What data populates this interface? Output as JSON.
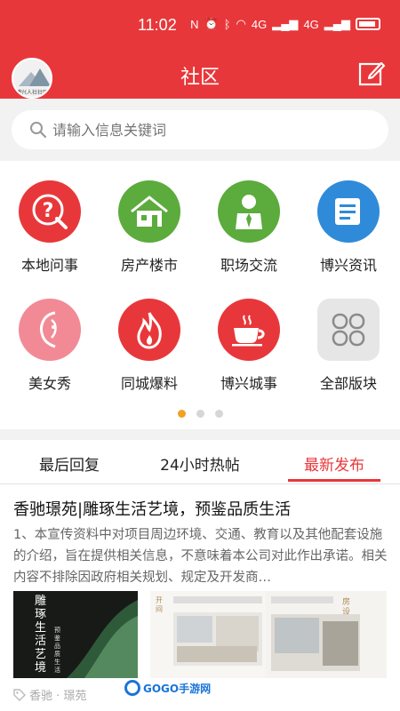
{
  "status_bar": {
    "time": "11:02",
    "network_labels": [
      "4G",
      "4G"
    ]
  },
  "header": {
    "title": "社区",
    "avatar_caption": "博兴人社社区"
  },
  "search": {
    "placeholder": "请输入信息关键词"
  },
  "categories": [
    {
      "label": "本地问事",
      "icon": "question-pen-icon",
      "color": "#e8373a"
    },
    {
      "label": "房产楼市",
      "icon": "house-icon",
      "color": "#5cab3d"
    },
    {
      "label": "职场交流",
      "icon": "businessman-icon",
      "color": "#5cab3d"
    },
    {
      "label": "博兴资讯",
      "icon": "document-icon",
      "color": "#2f8bd9"
    },
    {
      "label": "美女秀",
      "icon": "woman-face-icon",
      "color": "#f28a96"
    },
    {
      "label": "同城爆料",
      "icon": "fire-icon",
      "color": "#e8373a"
    },
    {
      "label": "博兴城事",
      "icon": "coffee-cup-icon",
      "color": "#e8373a"
    },
    {
      "label": "全部版块",
      "icon": "grid-all-icon",
      "color": "#e6e6e6"
    }
  ],
  "pagination": {
    "pages": 3,
    "active": 1,
    "active_color": "#f2a024"
  },
  "tabs": [
    {
      "label": "最后回复",
      "active": false
    },
    {
      "label": "24小时热帖",
      "active": false
    },
    {
      "label": "最新发布",
      "active": true
    }
  ],
  "article": {
    "title": "香驰璟苑|雕琢生活艺境，预鉴品质生活",
    "summary": "1、本宣传资料中对项目周边环境、交通、教育以及其他配套设施的介绍，旨在提供相关信息，不意味着本公司对此作出承诺。相关内容不排除因政府相关规划、规定及开发商…",
    "images": [
      {
        "text_vertical_1": "雕琢生活艺境",
        "text_vertical_2": "预鉴品质生活"
      },
      {
        "caption": "开间"
      },
      {
        "caption": "房设计"
      }
    ],
    "tags": "香驰 · 璟苑"
  },
  "watermark": {
    "text": "GOGO手游网"
  },
  "colors": {
    "brand": "#e8373a",
    "accent": "#f2a024"
  }
}
